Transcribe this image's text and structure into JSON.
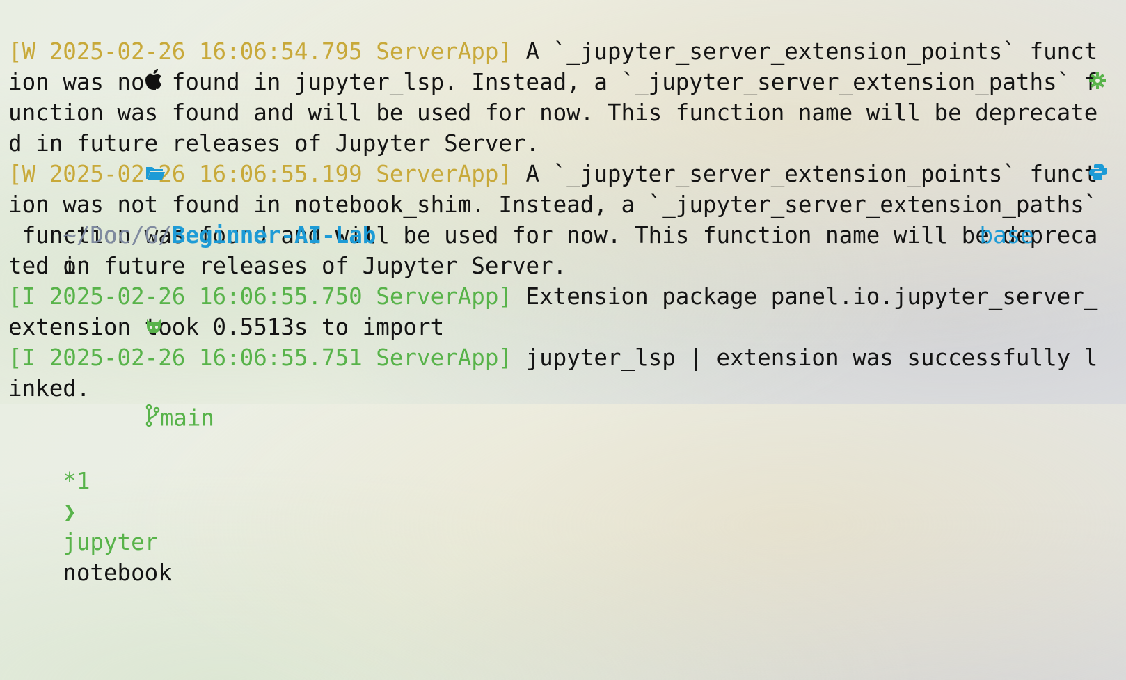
{
  "prompt": {
    "path_parts": [
      "~/",
      "Doc",
      "/",
      "G",
      "/",
      "Beginner-AI-Lab"
    ],
    "on_label": "on",
    "branch": "main",
    "dirty": "*1",
    "arrow": "❯",
    "command_program": "jupyter",
    "command_arg": "notebook",
    "env_name": "base"
  },
  "colors": {
    "path_dim": "#7f8aa0",
    "path_bold": "#1d9bd6",
    "git_green": "#58b34a",
    "warn_yellow": "#c8a93a",
    "info_green": "#58b34a"
  },
  "icons": [
    "apple-icon",
    "folder-icon",
    "github-icon",
    "git-branch-icon",
    "gear-icon",
    "python-icon"
  ],
  "output": [
    {
      "prefix": "[W 2025-02-26 16:06:54.795 ServerApp]",
      "level": "warning",
      "text": " A `_jupyter_server_extension_points` funct"
    },
    {
      "text": "ion was not found in jupyter_lsp. Instead, a `_jupyter_server_extension_paths` f"
    },
    {
      "text": "unction was found and will be used for now. This function name will be deprecate"
    },
    {
      "text": "d in future releases of Jupyter Server."
    },
    {
      "prefix": "[W 2025-02-26 16:06:55.199 ServerApp]",
      "level": "warning",
      "text": " A `_jupyter_server_extension_points` funct"
    },
    {
      "text": "ion was not found in notebook_shim. Instead, a `_jupyter_server_extension_paths`"
    },
    {
      "text": " function was found and will be used for now. This function name will be depreca"
    },
    {
      "text": "ted in future releases of Jupyter Server."
    },
    {
      "prefix": "[I 2025-02-26 16:06:55.750 ServerApp]",
      "level": "info",
      "text": " Extension package panel.io.jupyter_server_"
    },
    {
      "text": "extension took 0.5513s to import"
    },
    {
      "prefix": "[I 2025-02-26 16:06:55.751 ServerApp]",
      "level": "info",
      "text": " jupyter_lsp | extension was successfully l"
    },
    {
      "text": "inked."
    }
  ]
}
